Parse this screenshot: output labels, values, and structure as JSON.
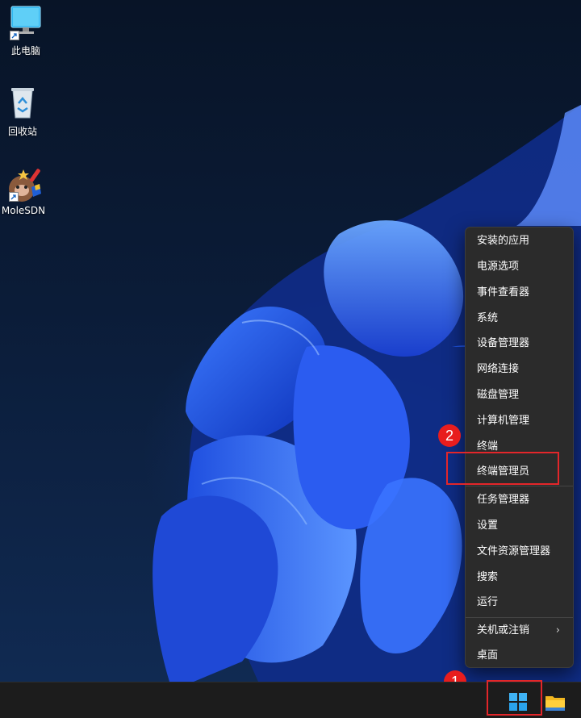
{
  "desktop": {
    "icons": [
      {
        "label": "此电脑",
        "icon": "computer-icon"
      },
      {
        "label": "回收站",
        "icon": "recycle-bin-icon"
      },
      {
        "label": "MoleSDN",
        "icon": "molesdn-app-icon"
      }
    ]
  },
  "context_menu": {
    "items": [
      {
        "label": "安装的应用"
      },
      {
        "label": "电源选项"
      },
      {
        "label": "事件查看器"
      },
      {
        "label": "系统"
      },
      {
        "label": "设备管理器"
      },
      {
        "label": "网络连接"
      },
      {
        "label": "磁盘管理"
      },
      {
        "label": "计算机管理"
      },
      {
        "label": "终端"
      },
      {
        "label": "终端管理员"
      },
      {
        "label": "任务管理器"
      },
      {
        "label": "设置"
      },
      {
        "label": "文件资源管理器"
      },
      {
        "label": "搜索"
      },
      {
        "label": "运行"
      },
      {
        "label": "关机或注销",
        "submenu_icon": "chevron-right-icon"
      },
      {
        "label": "桌面"
      }
    ],
    "submenu_glyph": "›"
  },
  "annotations": {
    "step1": "1",
    "step2": "2",
    "color": "#e3262a"
  },
  "taskbar": {
    "start_icon": "windows-start-icon",
    "explorer_icon": "file-explorer-icon"
  }
}
